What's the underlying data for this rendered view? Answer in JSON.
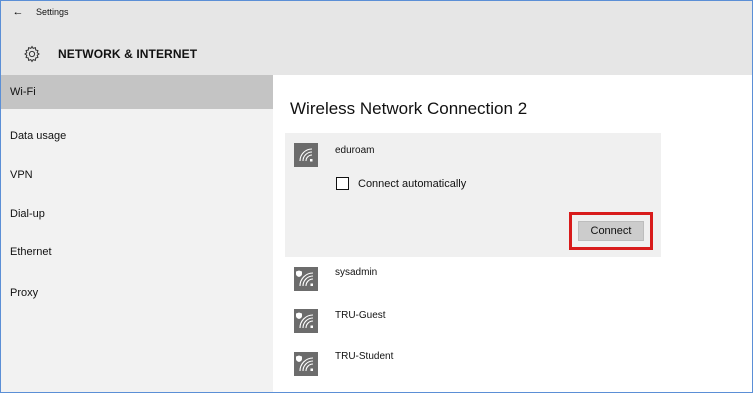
{
  "window": {
    "back_label": "←",
    "app_title": "Settings"
  },
  "section": {
    "title": "NETWORK & INTERNET",
    "icon": "gear-icon"
  },
  "sidebar": {
    "items": [
      {
        "label": "Wi-Fi",
        "active": true
      },
      {
        "label": "Data usage"
      },
      {
        "label": "VPN"
      },
      {
        "label": "Dial-up"
      },
      {
        "label": "Ethernet"
      },
      {
        "label": "Proxy"
      }
    ]
  },
  "main": {
    "heading": "Wireless Network Connection 2",
    "expanded_network": {
      "name": "eduroam",
      "icon": "wifi-icon",
      "connect_automatically_label": "Connect automatically",
      "connect_automatically_checked": false,
      "connect_label": "Connect"
    },
    "networks": [
      {
        "name": "sysadmin",
        "icon": "wifi-secured-icon"
      },
      {
        "name": "TRU-Guest",
        "icon": "wifi-secured-icon"
      },
      {
        "name": "TRU-Student",
        "icon": "wifi-secured-icon"
      }
    ]
  },
  "colors": {
    "header_bg": "#e6e6e6",
    "sidebar_bg": "#f2f2f2",
    "active_item_bg": "#c4c4c4",
    "expanded_card_bg": "#f0f0f0",
    "highlight": "#d81b1b",
    "frame_border": "#5b8fd6"
  }
}
